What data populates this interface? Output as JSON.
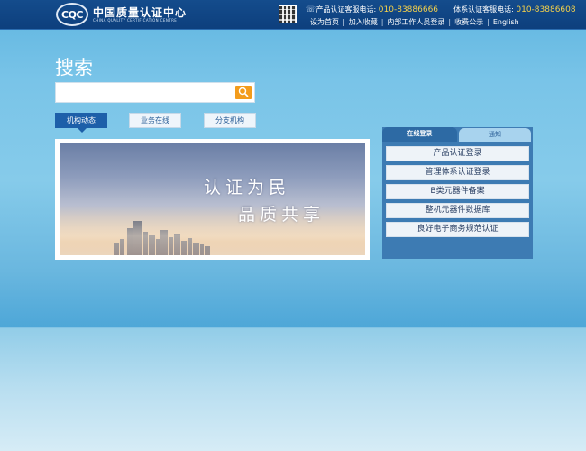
{
  "header": {
    "logo_mark": "CQC",
    "logo_cn": "中国质量认证中心",
    "logo_en": "CHINA QUALITY CERTIFICATION CENTRE",
    "hotline_product_label": "产品认证客服电话:",
    "hotline_product_number": "010-83886666",
    "hotline_system_label": "体系认证客服电话:",
    "hotline_system_number": "010-83886608",
    "links": [
      "设为首页",
      "加入收藏",
      "内部工作人员登录",
      "收费公示",
      "English"
    ]
  },
  "search": {
    "title": "搜索",
    "placeholder": "",
    "value": ""
  },
  "news_tabs": [
    {
      "label": "机构动态",
      "active": true
    },
    {
      "label": "业务在线",
      "active": false
    },
    {
      "label": "分支机构",
      "active": false
    }
  ],
  "banner": {
    "line1": "认证为民",
    "line2": "品质共享"
  },
  "login_panel": {
    "tabs": [
      {
        "label": "在线登录",
        "active": true
      },
      {
        "label": "通知",
        "active": false
      }
    ],
    "links": [
      "产品认证登录",
      "管理体系认证登录",
      "B类元器件备案",
      "整机元器件数据库",
      "良好电子商务规范认证"
    ]
  },
  "colors": {
    "header_bg": "#0d3f7d",
    "accent_orange": "#f39c1c",
    "active_tab": "#1d5fa9",
    "phone_number": "#f6d24a"
  }
}
